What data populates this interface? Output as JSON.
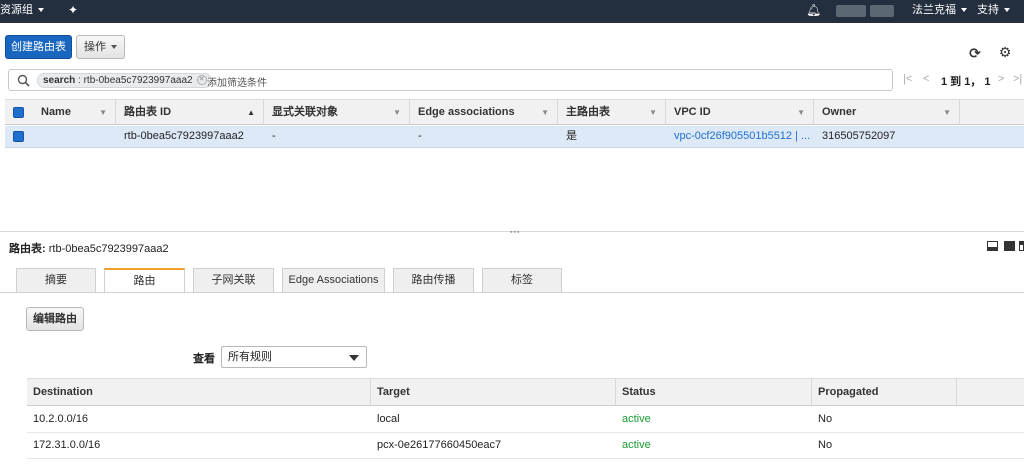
{
  "topbar": {
    "resource_groups": "资源组",
    "user": "法兰克福",
    "support": "支持"
  },
  "toolbar": {
    "create_label": "创建路由表",
    "actions_label": "操作"
  },
  "search": {
    "chip_key": "search",
    "chip_value": " : rtb-0bea5c7923997aaa2",
    "placeholder": "添加筛选条件"
  },
  "pager": {
    "text": "1 到 1， 1"
  },
  "grid": {
    "columns": [
      "Name",
      "路由表 ID",
      "显式关联对象",
      "Edge associations",
      "主路由表",
      "VPC ID",
      "Owner"
    ],
    "row": {
      "name": "",
      "id": "rtb-0bea5c7923997aaa2",
      "explicit": "-",
      "edge": "-",
      "main": "是",
      "vpc": "vpc-0cf26f905501b5512 | ...",
      "owner": "316505752097"
    }
  },
  "detail": {
    "title_label": "路由表:",
    "title_value": "rtb-0bea5c7923997aaa2",
    "tabs": [
      "摘要",
      "路由",
      "子网关联",
      "Edge Associations",
      "路由传播",
      "标签"
    ],
    "active_tab": "路由",
    "edit_routes_label": "编辑路由",
    "view_label": "查看",
    "view_value": "所有规则"
  },
  "routes": {
    "columns": [
      "Destination",
      "Target",
      "Status",
      "Propagated"
    ],
    "rows": [
      {
        "destination": "10.2.0.0/16",
        "target": "local",
        "status": "active",
        "propagated": "No"
      },
      {
        "destination": "172.31.0.0/16",
        "target": "pcx-0e26177660450eac7",
        "status": "active",
        "propagated": "No"
      }
    ]
  },
  "colors": {
    "topbar": "#232f3e",
    "primary": "#1866c0",
    "link": "#1f6fcf",
    "active_status": "#1a9a30",
    "tab_accent": "#f0a030"
  },
  "icons": [
    "chevron-down-icon",
    "pin-icon",
    "bell-icon",
    "refresh-icon",
    "gear-icon",
    "search-icon",
    "first-page-icon",
    "prev-page-icon",
    "next-page-icon",
    "last-page-icon",
    "sort-asc-icon",
    "sort-icon",
    "dropdown-icon"
  ]
}
